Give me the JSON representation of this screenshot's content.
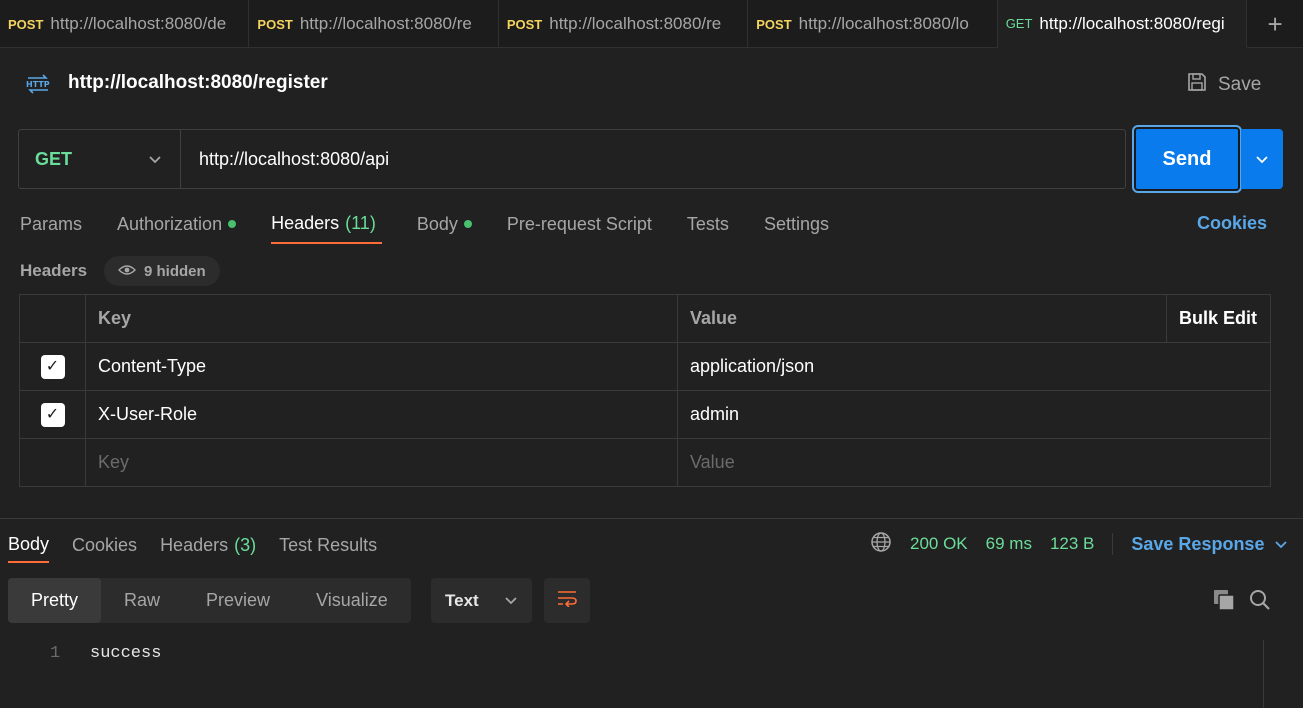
{
  "tabs": [
    {
      "method": "POST",
      "url": "http://localhost:8080/de"
    },
    {
      "method": "POST",
      "url": "http://localhost:8080/re"
    },
    {
      "method": "POST",
      "url": "http://localhost:8080/re"
    },
    {
      "method": "POST",
      "url": "http://localhost:8080/lo"
    },
    {
      "method": "GET",
      "url": "http://localhost:8080/regi"
    }
  ],
  "new_tab": "+",
  "request": {
    "title": "http://localhost:8080/register",
    "save_label": "Save",
    "method": "GET",
    "url": "http://localhost:8080/api",
    "send_label": "Send"
  },
  "request_tabs": {
    "params": "Params",
    "authorization": "Authorization",
    "headers": "Headers",
    "headers_count": "(11)",
    "body": "Body",
    "prerequest": "Pre-request Script",
    "tests": "Tests",
    "settings": "Settings",
    "cookies": "Cookies"
  },
  "headers_section": {
    "label": "Headers",
    "hidden": "9 hidden",
    "col_key": "Key",
    "col_value": "Value",
    "bulk_edit": "Bulk Edit",
    "rows": [
      {
        "key": "Content-Type",
        "value": "application/json",
        "checked": true
      },
      {
        "key": "X-User-Role",
        "value": "admin",
        "checked": true
      }
    ],
    "placeholder_key": "Key",
    "placeholder_value": "Value"
  },
  "response": {
    "tabs": {
      "body": "Body",
      "cookies": "Cookies",
      "headers": "Headers",
      "headers_count": "(3)",
      "test_results": "Test Results"
    },
    "status": "200 OK",
    "time": "69 ms",
    "size": "123 B",
    "save_response": "Save Response",
    "formats": {
      "pretty": "Pretty",
      "raw": "Raw",
      "preview": "Preview",
      "visualize": "Visualize"
    },
    "text_mode": "Text",
    "line_number": "1",
    "body_text": "success"
  },
  "colors": {
    "accent": "#097bed",
    "post": "#f4d35e",
    "get": "#6bdd9a",
    "active_tab": "#ff6c37"
  }
}
